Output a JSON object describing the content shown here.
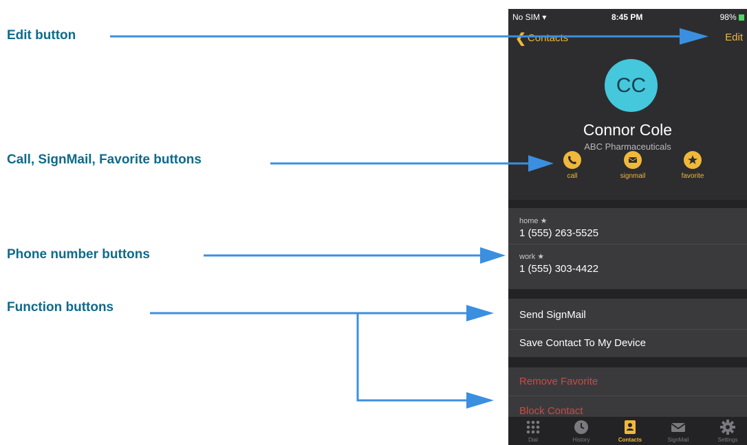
{
  "callouts": {
    "edit": "Edit button",
    "actions": "Call, SignMail, Favorite buttons",
    "phone_numbers": "Phone number buttons",
    "functions": "Function buttons"
  },
  "status_bar": {
    "carrier": "No SIM",
    "time": "8:45 PM",
    "battery": "98%"
  },
  "nav": {
    "back_label": "Contacts",
    "edit_label": "Edit"
  },
  "contact": {
    "initials": "CC",
    "name": "Connor Cole",
    "company": "ABC Pharmaceuticals"
  },
  "actions": [
    {
      "label": "call",
      "icon": "phone-icon"
    },
    {
      "label": "signmail",
      "icon": "envelope-icon"
    },
    {
      "label": "favorite",
      "icon": "star-icon"
    }
  ],
  "phones": [
    {
      "type": "home",
      "number": "1 (555) 263-5525"
    },
    {
      "type": "work",
      "number": "1 (555) 303-4422"
    }
  ],
  "functions": {
    "send_signmail": "Send SignMail",
    "save_contact": "Save Contact To My Device"
  },
  "danger_functions": {
    "remove_favorite": "Remove Favorite",
    "block_contact": "Block Contact"
  },
  "tabs": [
    {
      "label": "Dial",
      "icon": "keypad-icon"
    },
    {
      "label": "History",
      "icon": "clock-icon"
    },
    {
      "label": "Contacts",
      "icon": "contacts-icon",
      "active": true
    },
    {
      "label": "SignMail",
      "icon": "envelope-icon"
    },
    {
      "label": "Settings",
      "icon": "gear-icon"
    }
  ],
  "colors": {
    "accent": "#f0b83a",
    "callout_text": "#0e6a8c",
    "arrow": "#3b8fe0",
    "avatar": "#45c7dc",
    "danger": "#cc4a44"
  }
}
